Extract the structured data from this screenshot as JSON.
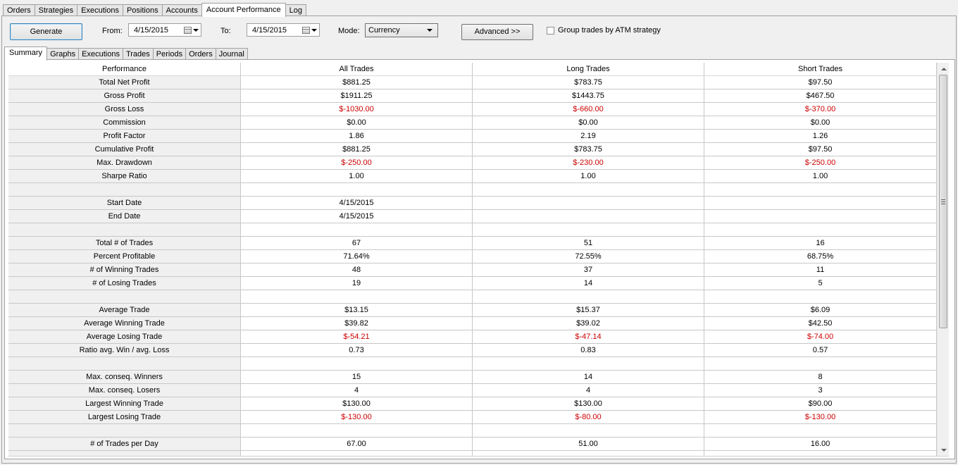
{
  "top_tabs": [
    "Orders",
    "Strategies",
    "Executions",
    "Positions",
    "Accounts",
    "Account Performance",
    "Log"
  ],
  "toolbar": {
    "generate_label": "Generate",
    "from_label": "From:",
    "from_value": "4/15/2015",
    "to_label": "To:",
    "to_value": "4/15/2015",
    "mode_label": "Mode:",
    "mode_value": "Currency",
    "advanced_label": "Advanced >>",
    "group_label": "Group trades by ATM strategy"
  },
  "sub_tabs": [
    "Summary",
    "Graphs",
    "Executions",
    "Trades",
    "Periods",
    "Orders",
    "Journal"
  ],
  "table": {
    "headers": [
      "Performance",
      "All Trades",
      "Long Trades",
      "Short Trades"
    ],
    "rows": [
      [
        "Total Net Profit",
        "$881.25",
        "$783.75",
        "$97.50"
      ],
      [
        "Gross Profit",
        "$1911.25",
        "$1443.75",
        "$467.50"
      ],
      [
        "Gross Loss",
        "$-1030.00",
        "$-660.00",
        "$-370.00"
      ],
      [
        "Commission",
        "$0.00",
        "$0.00",
        "$0.00"
      ],
      [
        "Profit Factor",
        "1.86",
        "2.19",
        "1.26"
      ],
      [
        "Cumulative Profit",
        "$881.25",
        "$783.75",
        "$97.50"
      ],
      [
        "Max. Drawdown",
        "$-250.00",
        "$-230.00",
        "$-250.00"
      ],
      [
        "Sharpe Ratio",
        "1.00",
        "1.00",
        "1.00"
      ],
      [
        "",
        "",
        "",
        ""
      ],
      [
        "Start Date",
        "4/15/2015",
        "",
        ""
      ],
      [
        "End Date",
        "4/15/2015",
        "",
        ""
      ],
      [
        "",
        "",
        "",
        ""
      ],
      [
        "Total # of Trades",
        "67",
        "51",
        "16"
      ],
      [
        "Percent Profitable",
        "71.64%",
        "72.55%",
        "68.75%"
      ],
      [
        "# of Winning Trades",
        "48",
        "37",
        "11"
      ],
      [
        "# of Losing Trades",
        "19",
        "14",
        "5"
      ],
      [
        "",
        "",
        "",
        ""
      ],
      [
        "Average Trade",
        "$13.15",
        "$15.37",
        "$6.09"
      ],
      [
        "Average Winning Trade",
        "$39.82",
        "$39.02",
        "$42.50"
      ],
      [
        "Average Losing Trade",
        "$-54.21",
        "$-47.14",
        "$-74.00"
      ],
      [
        "Ratio avg. Win / avg. Loss",
        "0.73",
        "0.83",
        "0.57"
      ],
      [
        "",
        "",
        "",
        ""
      ],
      [
        "Max. conseq. Winners",
        "15",
        "14",
        "8"
      ],
      [
        "Max. conseq. Losers",
        "4",
        "4",
        "3"
      ],
      [
        "Largest Winning Trade",
        "$130.00",
        "$130.00",
        "$90.00"
      ],
      [
        "Largest Losing Trade",
        "$-130.00",
        "$-80.00",
        "$-130.00"
      ],
      [
        "",
        "",
        "",
        ""
      ],
      [
        "# of Trades per Day",
        "67.00",
        "51.00",
        "16.00"
      ],
      [
        "",
        "",
        "",
        ""
      ]
    ]
  },
  "colors": {
    "negative": "#cc0000",
    "label_column_bg": "#f0f0f0",
    "grid_line": "#c8c8c8"
  }
}
